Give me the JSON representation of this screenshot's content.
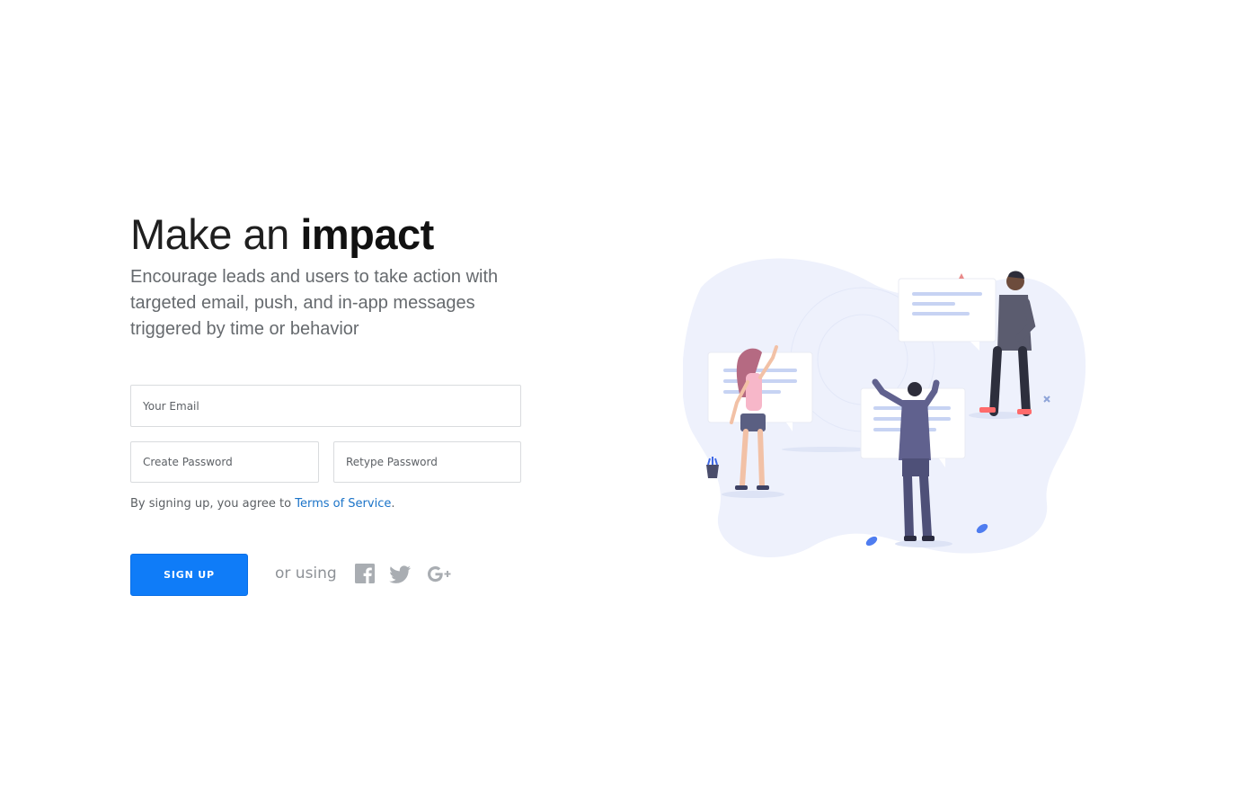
{
  "hero": {
    "headline_light": "Make an ",
    "headline_bold": "impact",
    "subhead": "Encourage leads and users to take action with targeted email, push, and in-app messages triggered by time or behavior"
  },
  "form": {
    "email_placeholder": "Your Email",
    "password_placeholder": "Create Password",
    "retype_placeholder": "Retype Password",
    "terms_prefix": "By signing up, you agree to ",
    "terms_link": "Terms of Service",
    "terms_suffix": ".",
    "signup_label": "SIGN UP",
    "or_using": "or using"
  },
  "social": {
    "icons": [
      "facebook-icon",
      "twitter-icon",
      "google-plus-icon"
    ]
  },
  "colors": {
    "accent": "#0f7cf8",
    "link": "#1a73c8",
    "icon_gray": "#a9adb2",
    "blob": "#eef1fc"
  }
}
